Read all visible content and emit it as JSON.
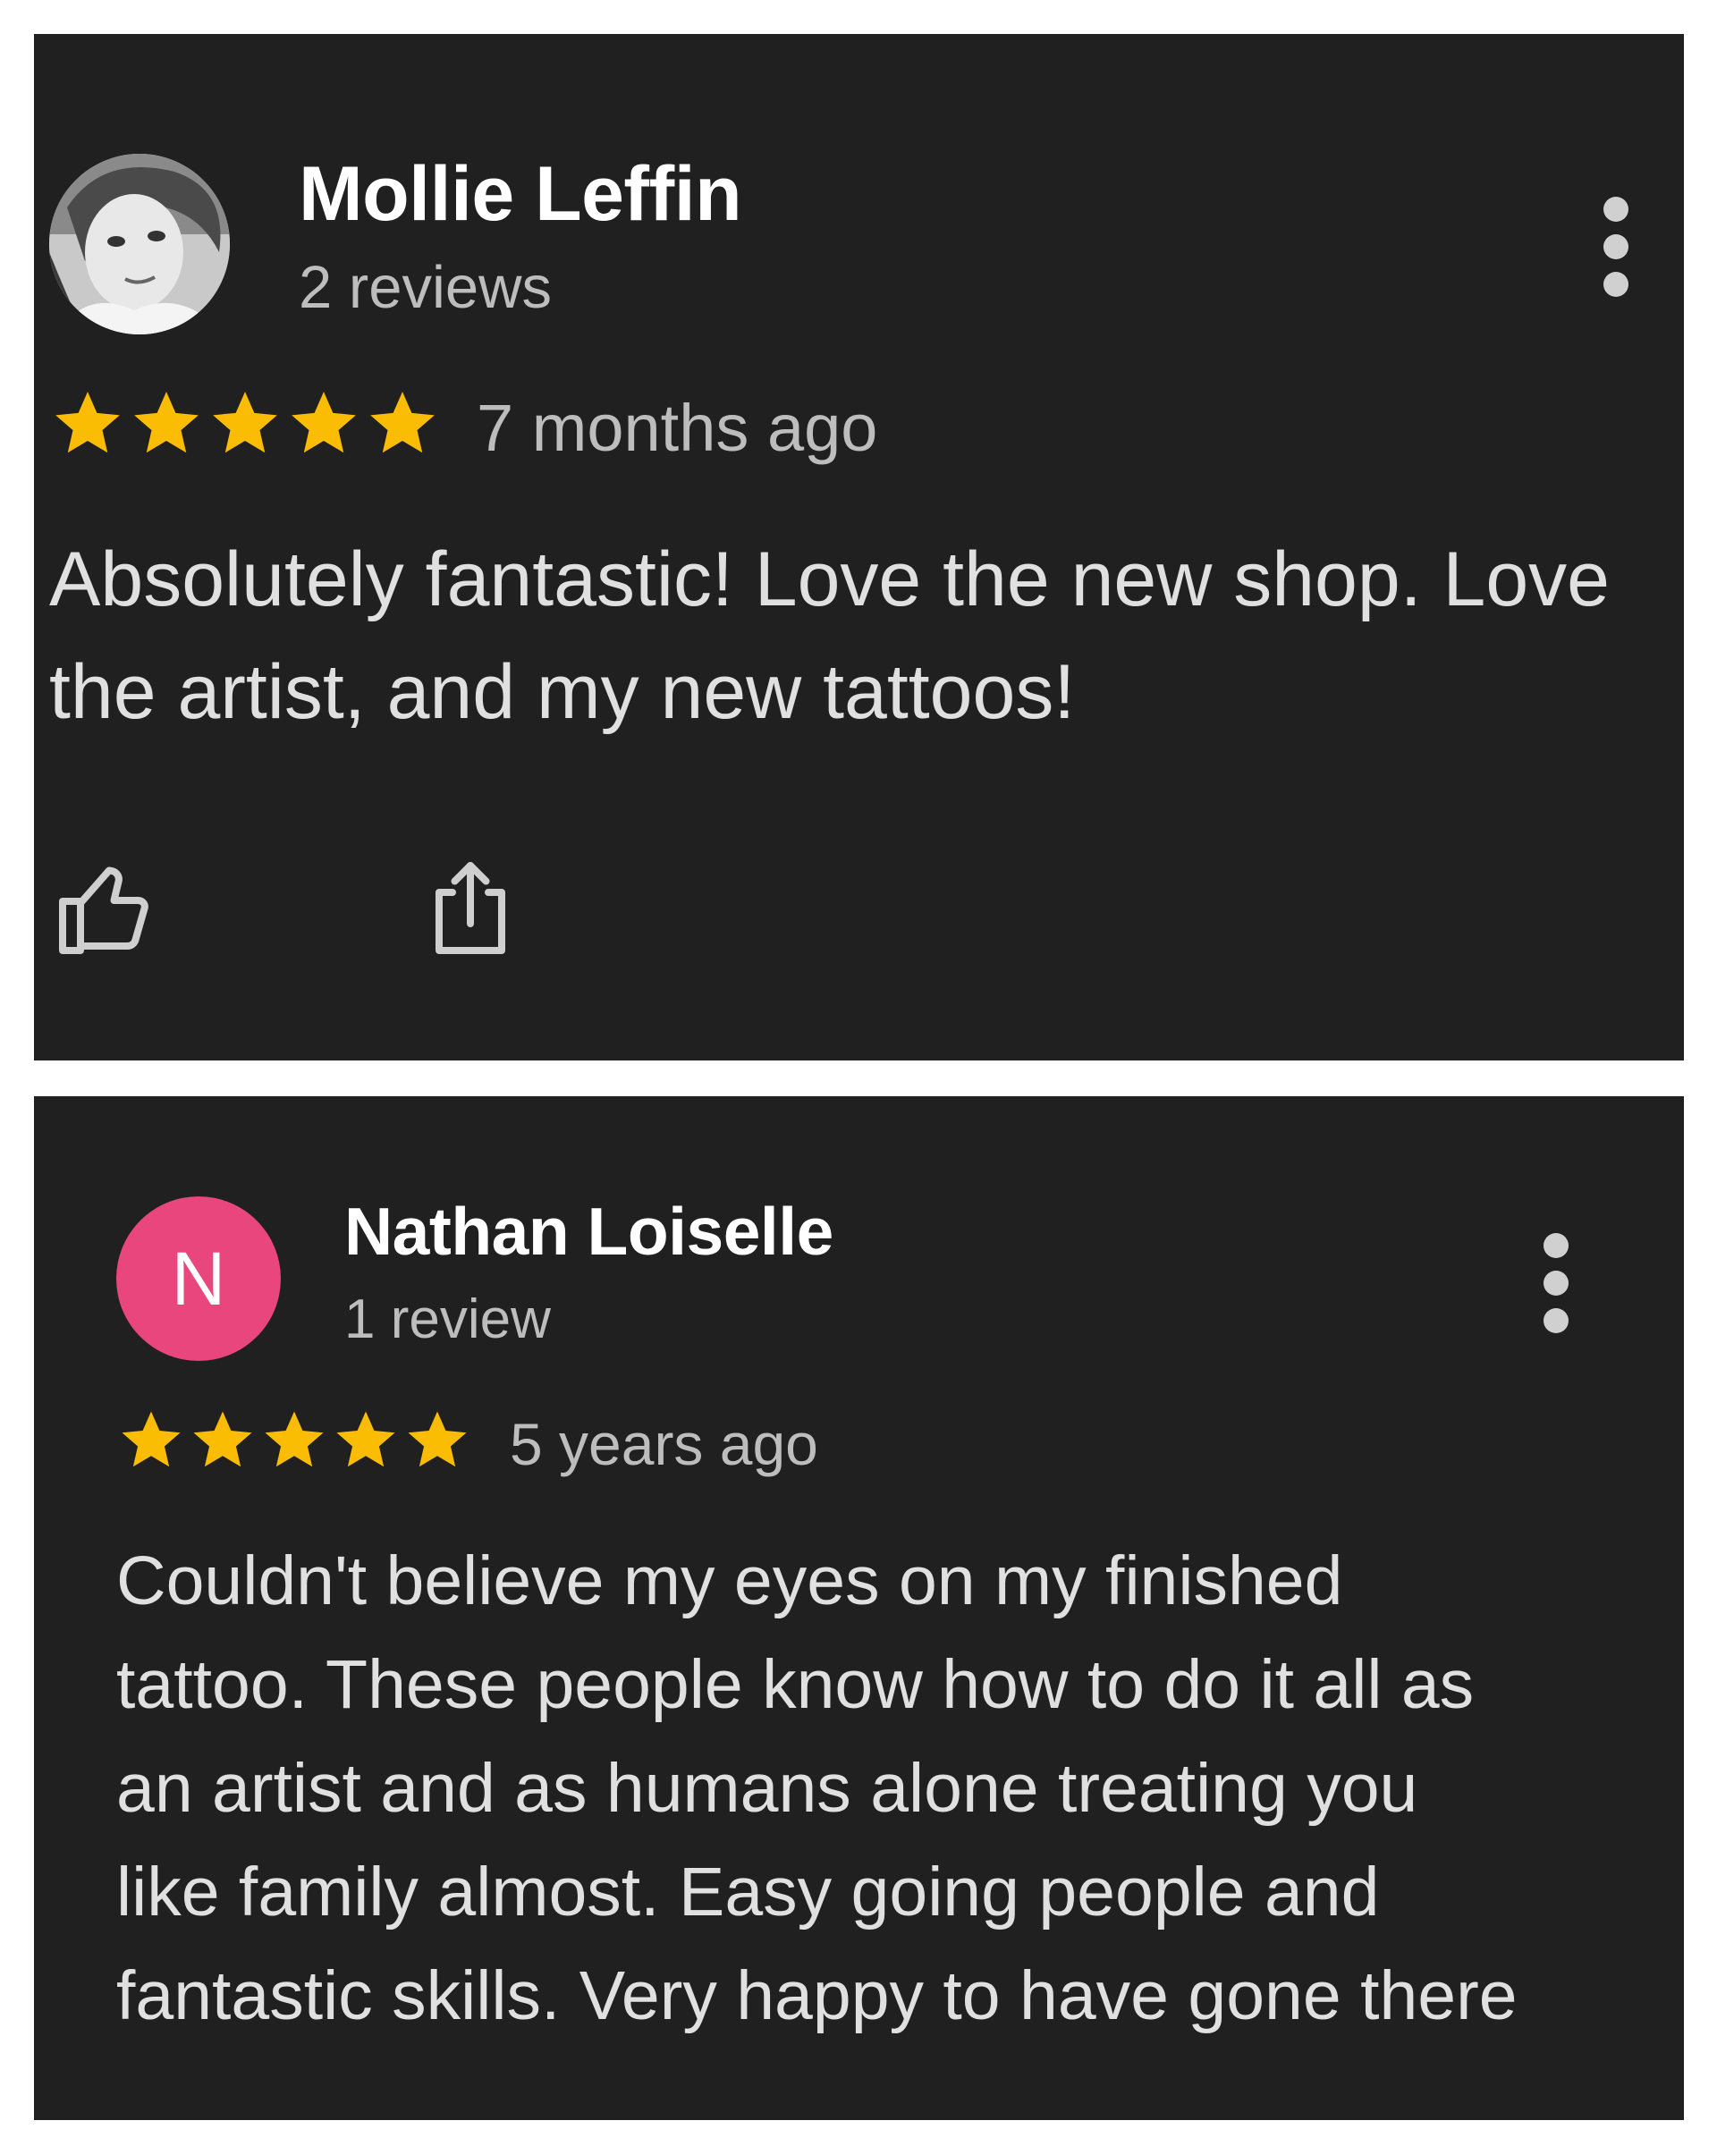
{
  "reviews": [
    {
      "author": "Mollie Leffin",
      "review_count": "2 reviews",
      "rating": 5,
      "time": "7 months ago",
      "text_lines": [
        "Absolutely fantastic! Love the new shop. Love",
        "the artist, and my new tattoos!"
      ],
      "avatar": "profile-photo"
    },
    {
      "author": "Nathan Loiselle",
      "review_count": "1 review",
      "rating": 5,
      "time": "5 years ago",
      "avatar_letter": "N",
      "text_lines": [
        "Couldn't believe my eyes on my finished",
        "tattoo. These people know how to do it all as",
        "an artist and as humans alone treating you",
        "like family almost. Easy going people and",
        "fantastic skills. Very happy to have gone there"
      ]
    }
  ],
  "colors": {
    "card_bg": "#202020",
    "star": "#fbbc04",
    "avatar_n": "#e8467c",
    "page_bg": "#ffffff"
  },
  "icons": {
    "like": "thumb-up-icon",
    "share": "share-icon",
    "more": "more-vert-icon",
    "star": "star-icon"
  }
}
